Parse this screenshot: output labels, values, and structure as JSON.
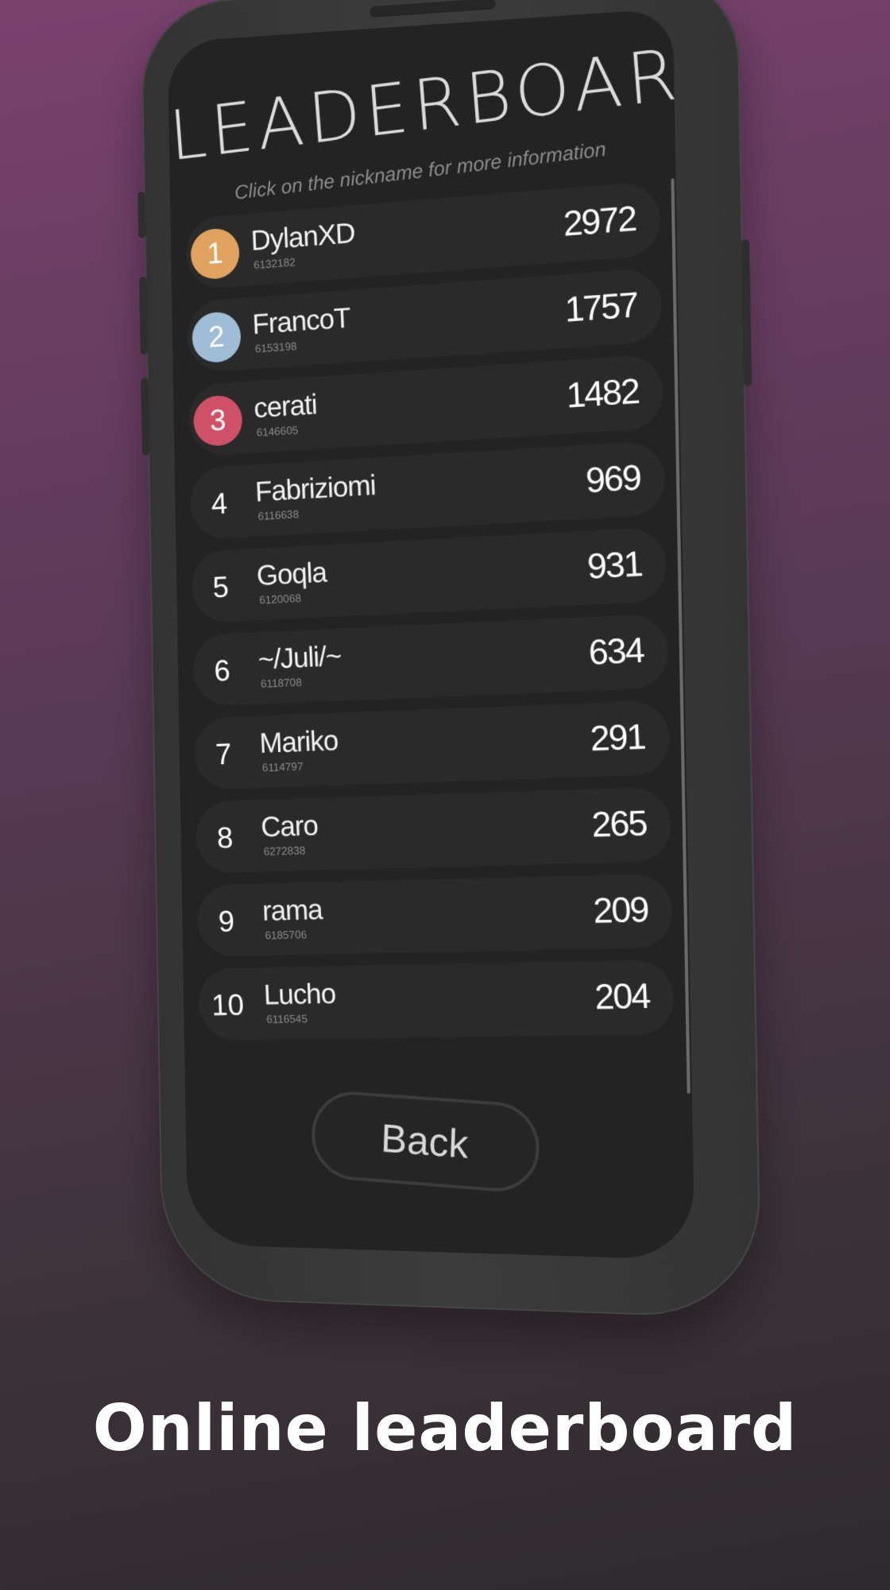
{
  "screen": {
    "title": "LEADERBOARD",
    "subtitle": "Click on the nickname for more information",
    "back_label": "Back"
  },
  "leaderboard": [
    {
      "rank": "1",
      "nickname": "DylanXD",
      "id": "6132182",
      "score": "2972",
      "medal": "gold"
    },
    {
      "rank": "2",
      "nickname": "FrancoT",
      "id": "6153198",
      "score": "1757",
      "medal": "silver"
    },
    {
      "rank": "3",
      "nickname": "cerati",
      "id": "6146605",
      "score": "1482",
      "medal": "bronze"
    },
    {
      "rank": "4",
      "nickname": "Fabriziomi",
      "id": "6116638",
      "score": "969",
      "medal": ""
    },
    {
      "rank": "5",
      "nickname": "Goqla",
      "id": "6120068",
      "score": "931",
      "medal": ""
    },
    {
      "rank": "6",
      "nickname": "~/Juli/~",
      "id": "6118708",
      "score": "634",
      "medal": ""
    },
    {
      "rank": "7",
      "nickname": "Mariko",
      "id": "6114797",
      "score": "291",
      "medal": ""
    },
    {
      "rank": "8",
      "nickname": "Caro",
      "id": "6272838",
      "score": "265",
      "medal": ""
    },
    {
      "rank": "9",
      "nickname": "rama",
      "id": "6185706",
      "score": "209",
      "medal": ""
    },
    {
      "rank": "10",
      "nickname": "Lucho",
      "id": "6116545",
      "score": "204",
      "medal": ""
    }
  ],
  "caption": "Online leaderboard",
  "colors": {
    "gold": "#e0a35f",
    "silver": "#9fbdd4",
    "bronze": "#d05068",
    "screen_bg": "#232323",
    "row_bg": "#2a2a2a"
  }
}
